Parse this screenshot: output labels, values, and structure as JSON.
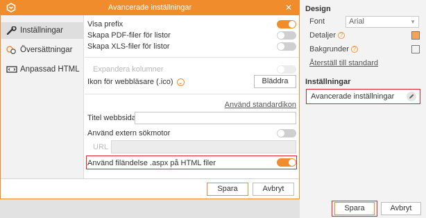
{
  "dialog": {
    "title": "Avancerade inställningar",
    "close_icon": "close-icon",
    "nav": [
      {
        "label": "Inställningar",
        "icon": "wrench-icon",
        "active": true
      },
      {
        "label": "Översättningar",
        "icon": "translate-icon",
        "active": false
      },
      {
        "label": "Anpassad HTML",
        "icon": "html-icon",
        "active": false
      }
    ],
    "settings": {
      "visa_prefix": "Visa prefix",
      "skapa_pdf": "Skapa PDF-filer för listor",
      "skapa_xls": "Skapa XLS-filer för listor",
      "expandera": "Expandera kolumner",
      "ikon": "Ikon för webbläsare (.ico)",
      "browse": "Bläddra",
      "use_default_icon": "Använd standardikon",
      "titel": "Titel webbsida",
      "titel_value": "",
      "extern": "Använd extern sökmotor",
      "url_label": "URL",
      "url_value": "",
      "aspx": "Använd filändelse .aspx på HTML filer"
    },
    "toggles": {
      "visa_prefix": true,
      "skapa_pdf": false,
      "skapa_xls": false,
      "expandera": false,
      "extern": false,
      "aspx": true
    },
    "save": "Spara",
    "cancel": "Avbryt"
  },
  "panel": {
    "design_heading": "Design",
    "font_label": "Font",
    "font_value": "Arial",
    "detaljer_label": "Detaljer",
    "bakgrunder_label": "Bakgrunder",
    "reset_link": "Återställ till standard",
    "settings_heading": "Inställningar",
    "advanced_item": "Avancerade inställningar",
    "save": "Spara",
    "cancel": "Avbryt"
  },
  "colors": {
    "accent": "#f08c2c",
    "highlight": "#e0222f",
    "detaljer_swatch": "#f5a35a",
    "bakgrunder_swatch": "#f3f3f3"
  }
}
